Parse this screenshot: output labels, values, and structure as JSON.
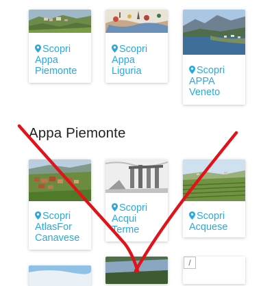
{
  "top_cards": [
    {
      "line1": "Scopri",
      "line2": "Appa",
      "line3": "Piemonte"
    },
    {
      "line1": "Scopri",
      "line2": "Appa",
      "line3": "Liguria"
    },
    {
      "line1": "Scopri",
      "line2": "APPA",
      "line3": "Veneto"
    }
  ],
  "section": {
    "title": "Appa Piemonte"
  },
  "section_cards": [
    {
      "line1": "Scopri",
      "line2": "AtlasFor",
      "line3": "Canavese"
    },
    {
      "line1": "Scopri",
      "line2": "Acqui",
      "line3": "Terme"
    },
    {
      "line1": "Scopri",
      "line2": "Acquese"
    }
  ],
  "partial_card": {
    "symbol": "/"
  },
  "colors": {
    "accent": "#29a9e1",
    "overlay": "#e0131b"
  }
}
